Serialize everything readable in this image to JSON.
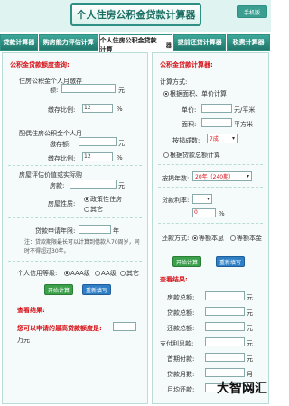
{
  "header": {
    "title": "个人住房公积金贷款计算器",
    "mobile_button": "手机版"
  },
  "tabs": [
    {
      "label": "贷款计算器"
    },
    {
      "label": "购房能力评估计算"
    },
    {
      "label": "个人住房公积金贷款计算",
      "tip": "器"
    },
    {
      "label": "提前还贷计算器"
    },
    {
      "label": "税费计算器"
    }
  ],
  "left": {
    "title": "公积金贷款额度查询:",
    "row1_label": "住房公积金个人月缴存",
    "row1_label2": "额:",
    "row1_unit": "元",
    "rate1_label": "缴存比例:",
    "rate1_value": "12",
    "rate_unit": "%",
    "row2_label": "配偶住房公积金个人月",
    "row2_label2": "缴存额:",
    "row2_unit": "元",
    "rate2_label": "缴存比例:",
    "rate2_value": "12",
    "eval_label": "房屋评估价值或实际购",
    "eval_label2": "房款:",
    "eval_unit": "元",
    "nature_label": "房屋性质:",
    "nature_opt1": "政策性住房",
    "nature_opt2": "其它",
    "years_label": "贷款申请年限:",
    "years_unit": "年",
    "note": "注：贷款期限最长可以计算到借款人70周岁，同时不得超过30年。",
    "credit_label": "个人信用等级:",
    "credit_opt1": "AAA级",
    "credit_opt2": "AA级",
    "credit_opt3": "其它",
    "start_btn": "开始计算",
    "reset_btn": "重新填写",
    "result_title": "查看结果:",
    "result_label": "您可以申请的最高贷款额度是:",
    "result_unit": "万元"
  },
  "right": {
    "title": "公积金贷款计算器:",
    "method_label": "计算方式:",
    "method_opt1": "根据面积、单价计算",
    "price_label": "单价:",
    "price_unit": "元/平米",
    "area_label": "面积:",
    "area_unit": "平方米",
    "ratio_label": "按揭成数:",
    "ratio_value": "7成",
    "method_opt2": "根据贷款总额计算",
    "term_label": "按揭年数:",
    "term_value": "20年（240期）",
    "rate_label": "贷款利率:",
    "rate_unit": "%",
    "rate_value": "0",
    "repay_label": "还款方式:",
    "repay_opt1": "等额本息",
    "repay_opt2": "等额本金",
    "start_btn": "开始计算",
    "reset_btn": "重新填写",
    "result_title": "查看结果:",
    "res_rows": [
      {
        "label": "房款总额:",
        "unit": "元"
      },
      {
        "label": "贷款总额:",
        "unit": "元"
      },
      {
        "label": "还款总额:",
        "unit": "元"
      },
      {
        "label": "支付利息款:",
        "unit": "元"
      },
      {
        "label": "首期付款:",
        "unit": "元"
      },
      {
        "label": "贷款月数:",
        "unit": "月"
      },
      {
        "label": "月均还款:",
        "unit": "元"
      }
    ]
  },
  "watermark": "大智网汇"
}
